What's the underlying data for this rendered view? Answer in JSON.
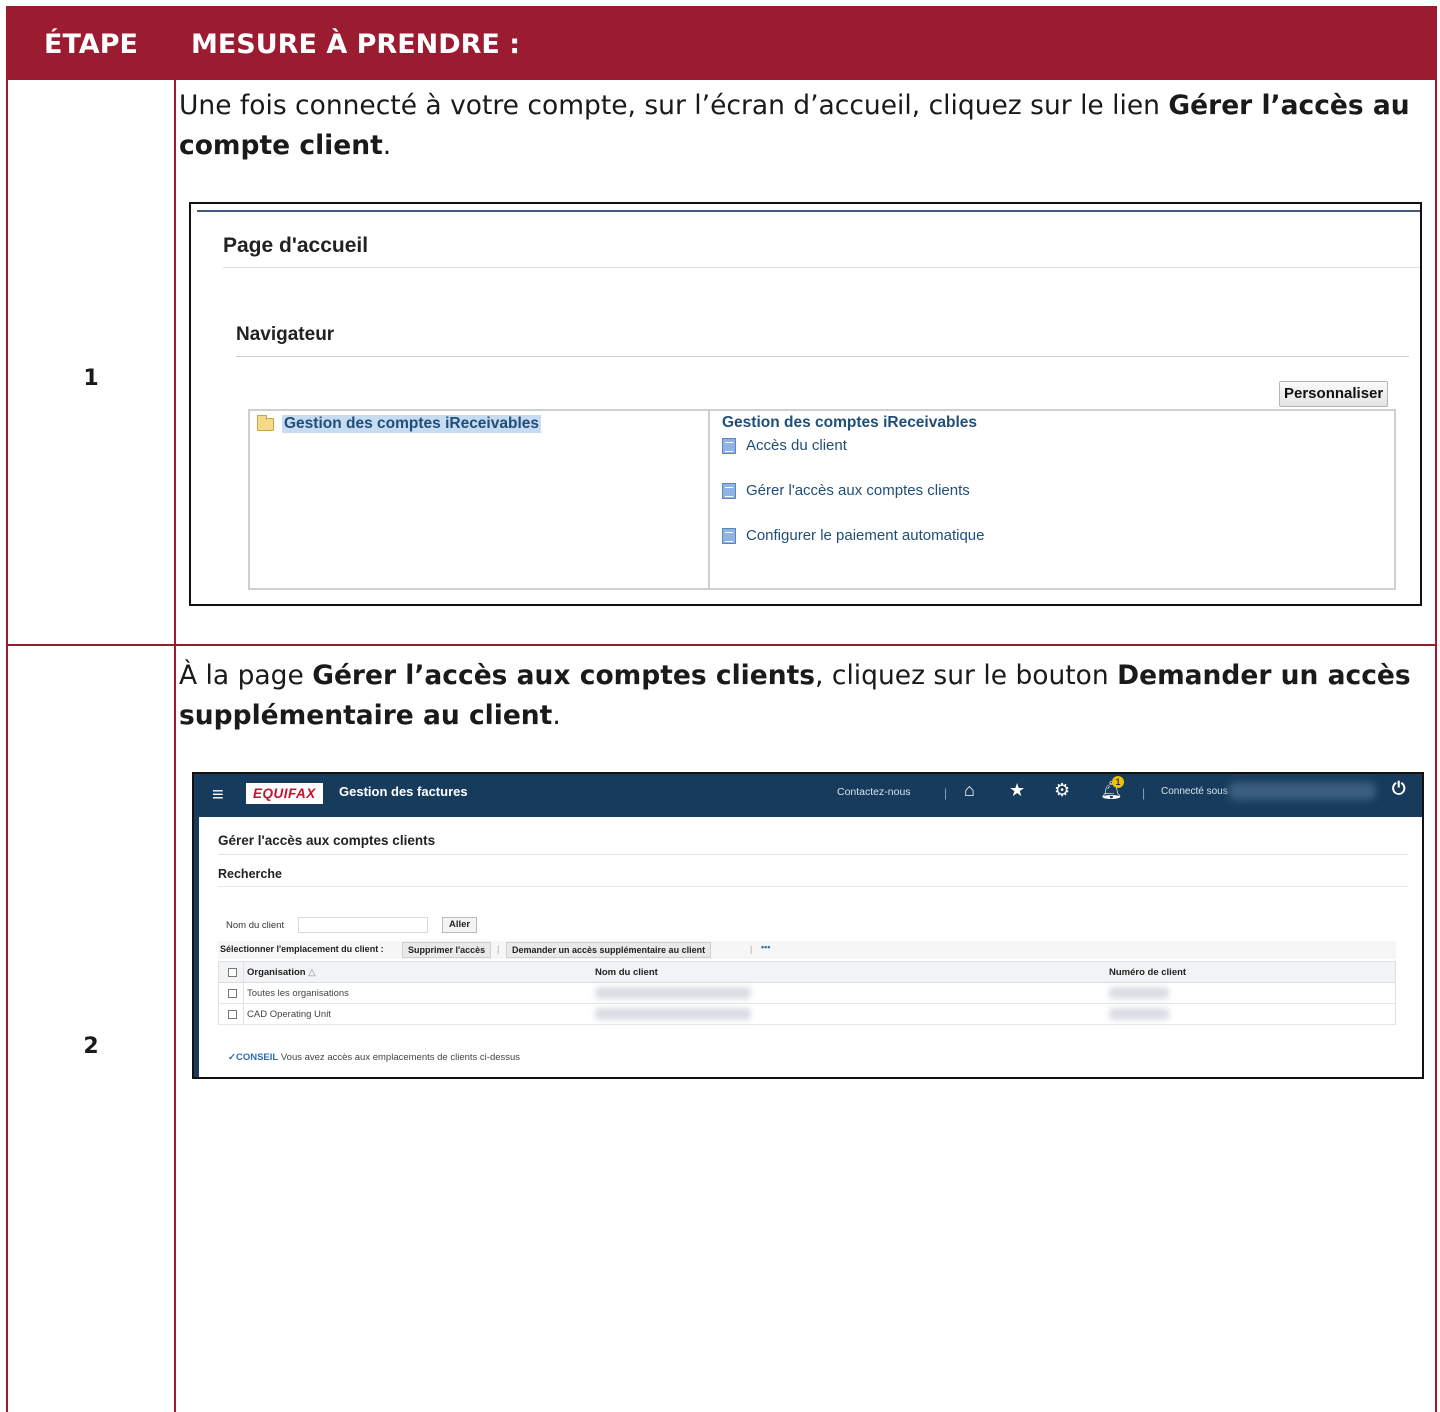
{
  "header": {
    "step_col": "ÉTAPE",
    "action_col": "MESURE À PRENDRE :"
  },
  "colors": {
    "accent": "#9b1b30",
    "equifax_nav": "#173b5c"
  },
  "steps": [
    {
      "number": "1",
      "text_1": "Une fois connecté à votre compte, sur l’écran d’accueil, cliquez sur le lien ",
      "bold_1": "Gérer l’accès au compte client",
      "text_2": "."
    },
    {
      "number": "2",
      "text_1": "À la page ",
      "bold_1": "Gérer l’accès aux comptes clients",
      "text_2": ", cliquez sur le bouton ",
      "bold_2": "Demander un accès supplémentaire au client",
      "text_3": "."
    }
  ],
  "screenshot1": {
    "page_title": "Page d'accueil",
    "navigator_title": "Navigateur",
    "customize_button": "Personnaliser",
    "left_item": "Gestion des comptes iReceivables",
    "right_title": "Gestion des comptes iReceivables",
    "links": [
      "Accès du client",
      "Gérer l'accès aux comptes clients",
      "Configurer le paiement automatique"
    ]
  },
  "screenshot2": {
    "menu_icon": "menu-icon",
    "logo_text": "EQUIFAX",
    "app_title": "Gestion des factures",
    "contact": "Contactez-nous",
    "notification_count": "1",
    "connected_as": "Connecté sous",
    "page_title": "Gérer l'accès aux comptes clients",
    "search_title": "Recherche",
    "field_label": "Nom du client",
    "go_button": "Aller",
    "toolbar_label": "Sélectionner l'emplacement du client :",
    "remove_button": "Supprimer l'accès",
    "request_button": "Demander un accès supplémentaire au client",
    "more": "•••",
    "columns": [
      "Organisation",
      "Nom du client",
      "Numéro de client"
    ],
    "sort_indicator": "△",
    "rows": [
      {
        "organisation": "Toutes les organisations"
      },
      {
        "organisation": "CAD Operating Unit"
      }
    ],
    "tip_label": "CONSEIL",
    "tip_text": "Vous avez accès aux emplacements de clients ci-dessus"
  }
}
